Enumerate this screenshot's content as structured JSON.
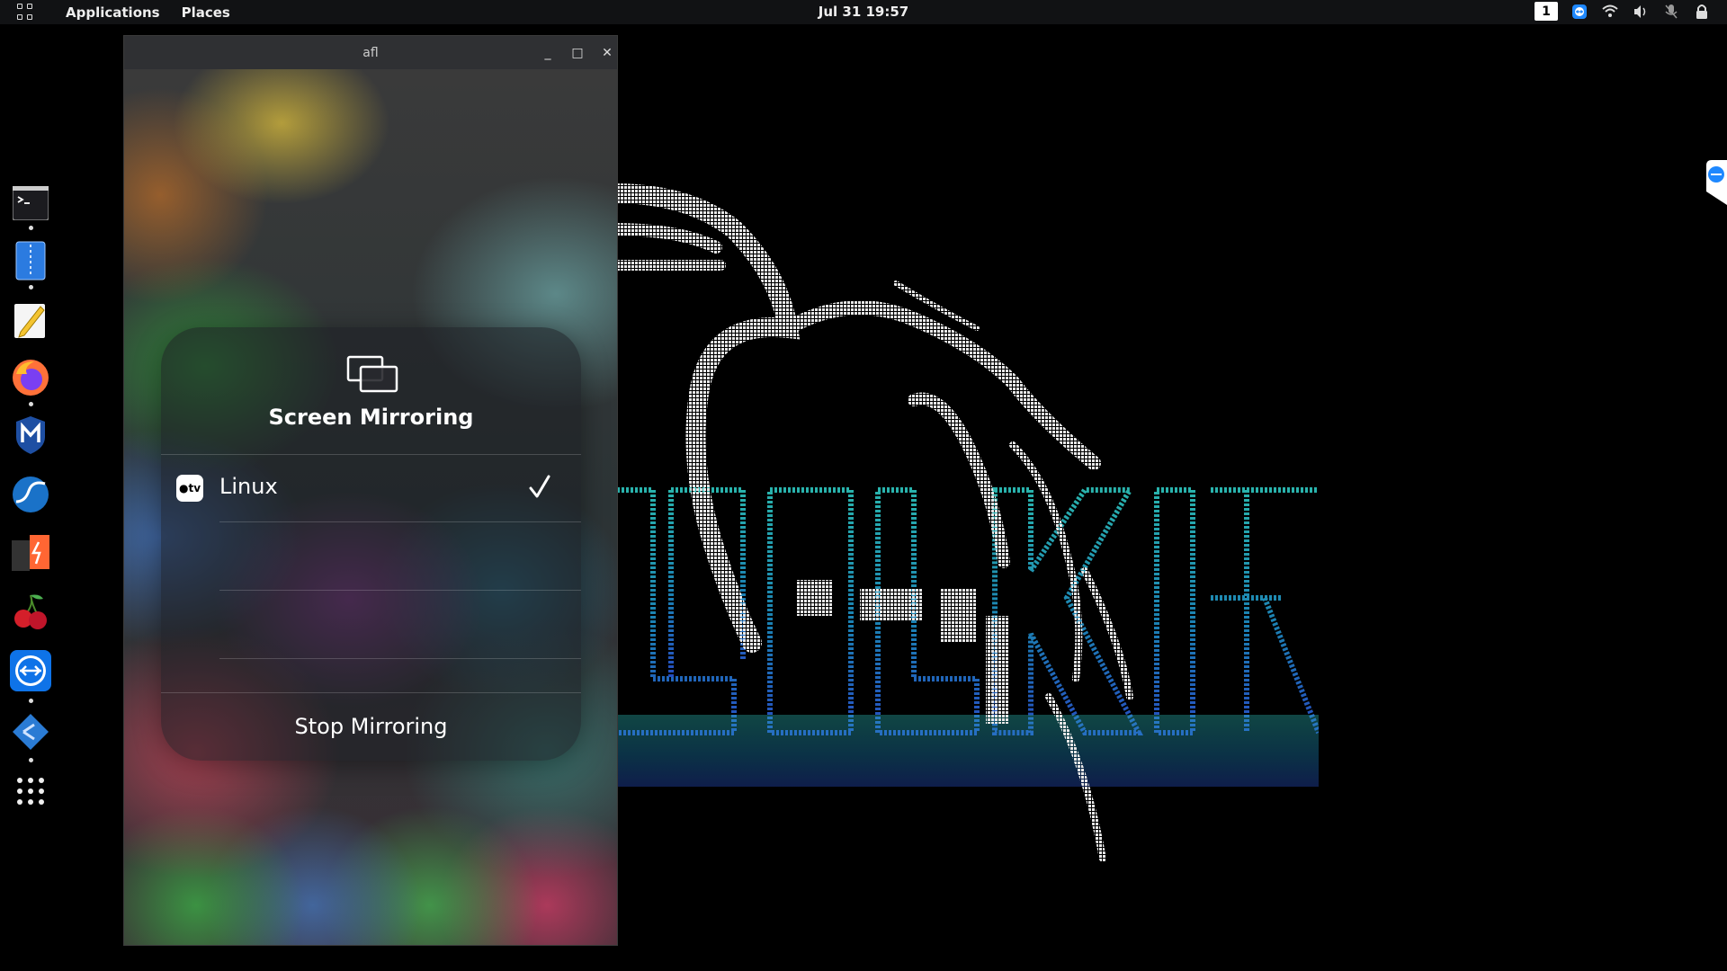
{
  "topbar": {
    "applications_label": "Applications",
    "places_label": "Places",
    "clock": "Jul 31  19:57",
    "workspace": "1"
  },
  "window": {
    "title": "afl",
    "minimize_glyph": "_",
    "maximize_glyph": "□",
    "close_glyph": "✕"
  },
  "mirroring_panel": {
    "title": "Screen Mirroring",
    "devices": [
      {
        "badge": "tv",
        "name": "Linux",
        "selected": true
      }
    ],
    "stop_label": "Stop Mirroring"
  },
  "dock": {
    "items": [
      "terminal-icon",
      "file-manager-icon",
      "text-editor-icon",
      "firefox-icon",
      "metasploit-icon",
      "wireshark-icon",
      "burpsuite-icon",
      "cherrytree-icon",
      "teamviewer-icon",
      "remmina-icon",
      "show-apps-icon"
    ]
  },
  "colors": {
    "accent_teal": "#1fb5b0",
    "accent_blue": "#2a6fd6",
    "teamviewer_blue": "#0e73e8"
  }
}
